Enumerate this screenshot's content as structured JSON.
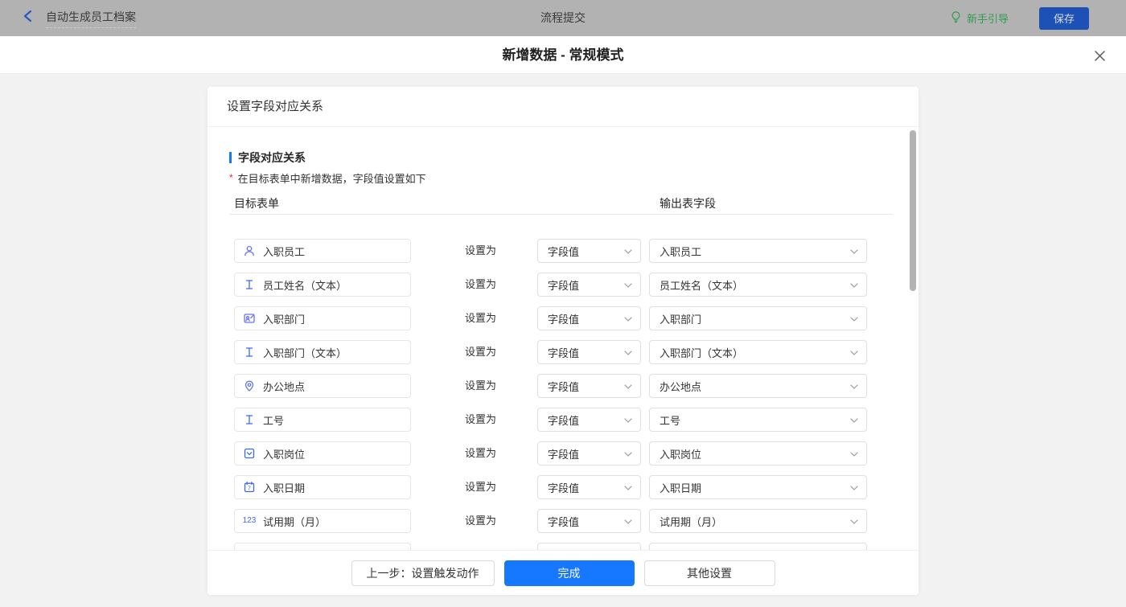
{
  "topbar": {
    "back_icon": "chevron-left",
    "title": "自动生成员工档案",
    "center_title": "流程提交",
    "guide_icon": "lightbulb",
    "guide_label": "新手引导",
    "save_label": "保存"
  },
  "modal": {
    "title": "新增数据 - 常规模式",
    "close_icon": "close"
  },
  "card": {
    "header": "设置字段对应关系",
    "section_title": "字段对应关系",
    "required_mark": "*",
    "description": "在目标表单中新增数据，字段值设置如下",
    "col_left": "目标表单",
    "col_right": "输出表字段",
    "set_as_label": "设置为",
    "rows": [
      {
        "icon": "user-icon",
        "field": "入职员工",
        "value_type": "字段值",
        "output": "入职员工"
      },
      {
        "icon": "text-icon",
        "field": "员工姓名（文本）",
        "value_type": "字段值",
        "output": "员工姓名（文本）"
      },
      {
        "icon": "dept-icon",
        "field": "入职部门",
        "value_type": "字段值",
        "output": "入职部门"
      },
      {
        "icon": "text-icon",
        "field": "入职部门（文本）",
        "value_type": "字段值",
        "output": "入职部门（文本）"
      },
      {
        "icon": "location-icon",
        "field": "办公地点",
        "value_type": "字段值",
        "output": "办公地点"
      },
      {
        "icon": "text-icon",
        "field": "工号",
        "value_type": "字段值",
        "output": "工号"
      },
      {
        "icon": "select-icon",
        "field": "入职岗位",
        "value_type": "字段值",
        "output": "入职岗位"
      },
      {
        "icon": "date-icon",
        "field": "入职日期",
        "value_type": "字段值",
        "output": "入职日期"
      },
      {
        "icon": "number-icon",
        "field": "试用期（月）",
        "value_type": "字段值",
        "output": "试用期（月）"
      },
      {
        "icon": "",
        "field": "",
        "value_type": "",
        "output": ""
      }
    ]
  },
  "footer": {
    "prev_label": "上一步：设置触发动作",
    "done_label": "完成",
    "other_label": "其他设置"
  },
  "colors": {
    "primary_blue": "#1677ff",
    "save_button_blue_dimmed": "#1d51b5",
    "guide_green": "#2f9d4e",
    "icon_blue": "#3f68e8",
    "icon_violet": "#6474f0",
    "required_red": "#f5222d",
    "topbar_dimmed_gray": "#b2b2b2",
    "body_gray": "#f2f2f2"
  }
}
